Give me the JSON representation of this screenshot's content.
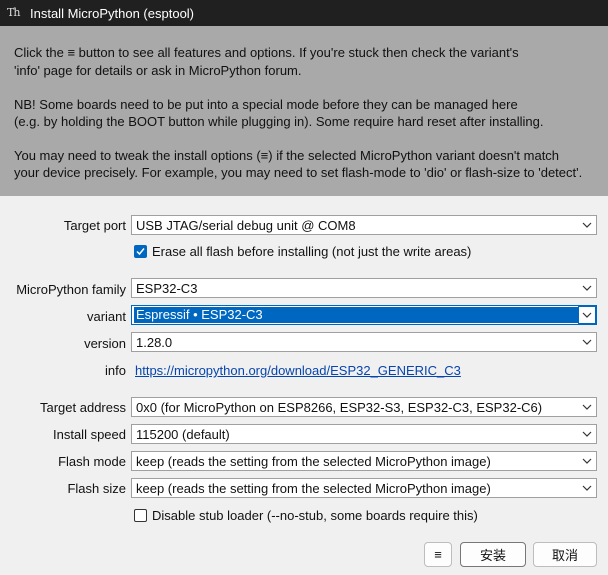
{
  "window": {
    "title": "Install MicroPython (esptool)",
    "icon": "Th"
  },
  "info_text": {
    "line1": "Click the ≡ button to see all features and options. If you're stuck then check the variant's",
    "line2": "'info' page for details or ask in MicroPython forum.",
    "line3": "NB! Some boards need to be put into a special mode before they can be managed here",
    "line4": "(e.g. by holding the BOOT button while plugging in). Some require hard reset after installing.",
    "line5": "You may need to tweak the install options (≡) if the selected MicroPython variant doesn't match",
    "line6": "your device precisely. For example, you may need to set flash-mode to 'dio' or flash-size to 'detect'."
  },
  "form": {
    "target_port": {
      "label": "Target port",
      "value": "USB JTAG/serial debug unit @ COM8"
    },
    "erase_flash": {
      "label": "Erase all flash before installing (not just the write areas)",
      "checked": true
    },
    "family": {
      "label": "MicroPython family",
      "value": "ESP32-C3"
    },
    "variant": {
      "label": "variant",
      "value": "Espressif • ESP32-C3"
    },
    "version": {
      "label": "version",
      "value": "1.28.0"
    },
    "info": {
      "label": "info",
      "link": "https://micropython.org/download/ESP32_GENERIC_C3"
    },
    "target_address": {
      "label": "Target address",
      "value": "0x0 (for MicroPython on ESP8266, ESP32-S3, ESP32-C3, ESP32-C6)"
    },
    "install_speed": {
      "label": "Install speed",
      "value": "115200 (default)"
    },
    "flash_mode": {
      "label": "Flash mode",
      "value": "keep (reads the setting from the selected MicroPython image)"
    },
    "flash_size": {
      "label": "Flash size",
      "value": "keep (reads the setting from the selected MicroPython image)"
    },
    "disable_stub": {
      "label": "Disable stub loader (--no-stub, some boards require this)",
      "checked": false
    }
  },
  "buttons": {
    "menu": "≡",
    "install": "安装",
    "cancel": "取消"
  },
  "colors": {
    "titlebar": "#202020",
    "info_panel": "#a9a9a9",
    "accent": "#0067c0",
    "link": "#0645ad"
  }
}
